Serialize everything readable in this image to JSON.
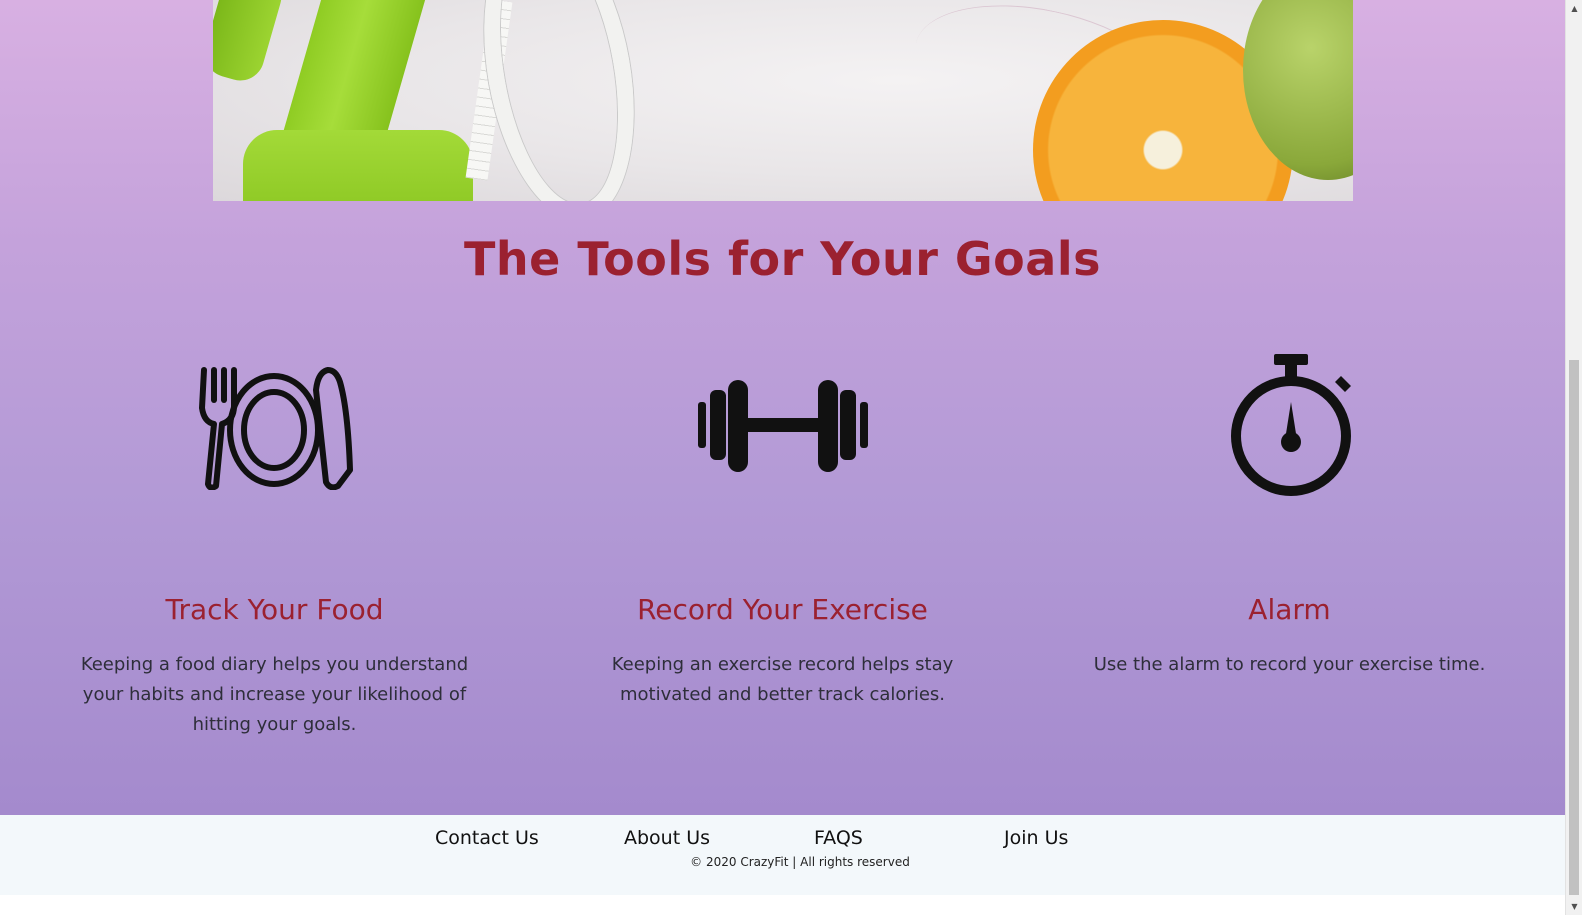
{
  "section": {
    "title": "The Tools for Your Goals"
  },
  "tools": [
    {
      "icon": "fork-plate-knife-icon",
      "title": "Track Your Food",
      "description": "Keeping a food diary helps you understand your habits and increase your likelihood of hitting your goals."
    },
    {
      "icon": "dumbbell-icon",
      "title": "Record Your Exercise",
      "description": "Keeping an exercise record helps stay motivated and better track calories."
    },
    {
      "icon": "stopwatch-icon",
      "title": "Alarm",
      "description": "Use the alarm to record your exercise time."
    }
  ],
  "footer": {
    "links": [
      "Contact Us",
      "About Us",
      "FAQS",
      "Join Us"
    ],
    "copyright": "© 2020 CrazyFit | All rights reserved"
  },
  "colors": {
    "accent": "#9b2130",
    "footer_bg": "#f3f8fb",
    "gradient_top": "#d8b0e2",
    "gradient_bottom": "#a48acd"
  }
}
